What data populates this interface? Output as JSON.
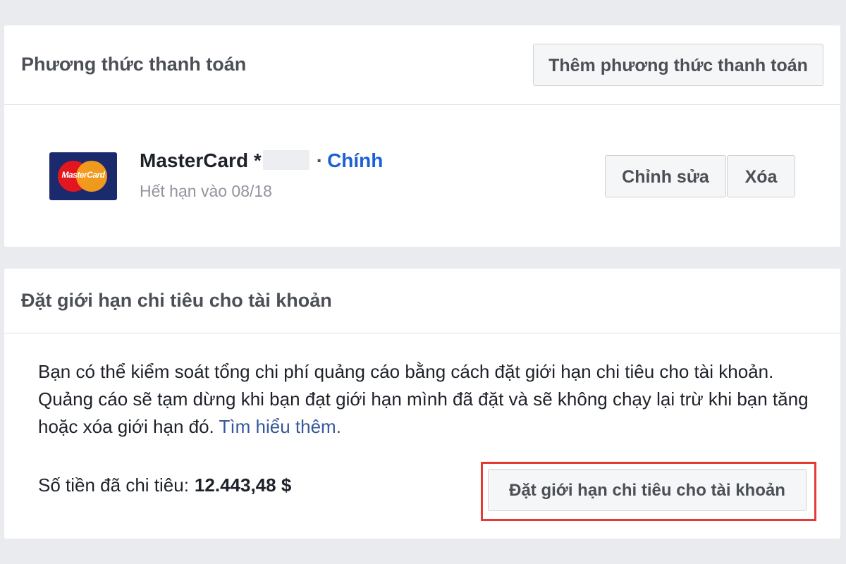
{
  "payment_panel": {
    "title": "Phương thức thanh toán",
    "add_button": "Thêm phương thức thanh toán",
    "card": {
      "logo_icon": "mastercard-logo-icon",
      "logo_text": "MasterCard",
      "name": "MasterCard *",
      "separator": "·",
      "primary_label": "Chính",
      "expiry": "Hết hạn vào 08/18",
      "edit_button": "Chỉnh sửa",
      "delete_button": "Xóa"
    }
  },
  "limit_panel": {
    "title": "Đặt giới hạn chi tiêu cho tài khoản",
    "description": "Bạn có thể kiểm soát tổng chi phí quảng cáo bằng cách đặt giới hạn chi tiêu cho tài khoản. Quảng cáo sẽ tạm dừng khi bạn đạt giới hạn mình đã đặt và sẽ không chạy lại trừ khi bạn tăng hoặc xóa giới hạn đó.",
    "learn_more": "Tìm hiểu thêm.",
    "spent_label": "Số tiền đã chi tiêu:",
    "spent_amount": "12.443,48 $",
    "set_limit_button": "Đặt giới hạn chi tiêu cho tài khoản"
  },
  "colors": {
    "background": "#e9ebee",
    "link": "#1b61d6",
    "highlight": "#e53935"
  }
}
